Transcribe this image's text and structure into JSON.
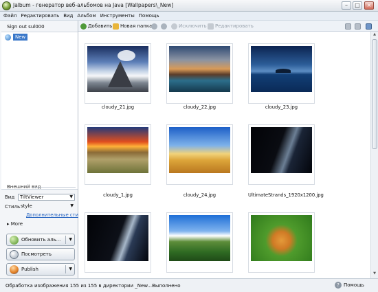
{
  "window": {
    "title": "Jalbum - генератор веб-альбомов на Java [Wallpapers\\_New]"
  },
  "menu": [
    "Файл",
    "Редактировать",
    "Вид",
    "Альбом",
    "Инструменты",
    "Помощь"
  ],
  "toolbar": {
    "add_label": "Добавить",
    "new_folder_label": "Новая папка",
    "exclude_label": "Исключить",
    "edit_label": "Редактировать"
  },
  "sidebar": {
    "sign_out": "Sign out sul000",
    "tree_node": "New",
    "appearance_title": "Внешний вид",
    "view_label": "Вид",
    "view_value": "TiltViewer",
    "style_label": "Стиль",
    "style_value": "style",
    "extra_styles_link": "Дополнительные стили",
    "more_label": "More",
    "update_button": "Обновить аль...",
    "preview_button": "Посмотреть",
    "publish_button": "Publish"
  },
  "thumbnails": [
    {
      "name": "cloudy_21.jpg"
    },
    {
      "name": "cloudy_22.jpg"
    },
    {
      "name": "cloudy_23.jpg"
    },
    {
      "name": "cloudy_1.jpg"
    },
    {
      "name": "cloudy_24.jpg"
    },
    {
      "name": "UltimateStrands_1920x1200.jpg"
    },
    {
      "name": ""
    },
    {
      "name": ""
    },
    {
      "name": ""
    }
  ],
  "status": {
    "text": "Обработка изображения 155 из 155 в директории _New...Выполнено",
    "help_label": "Помощь"
  }
}
